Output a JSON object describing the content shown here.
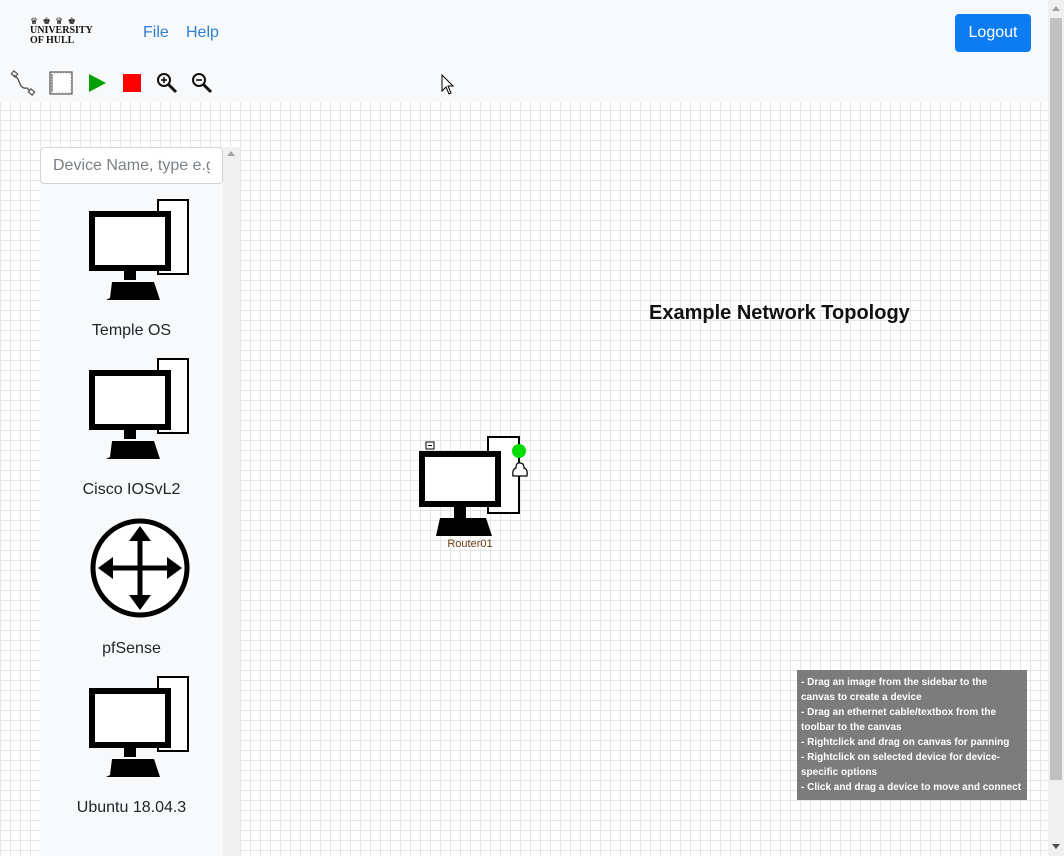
{
  "header": {
    "logo": {
      "crowns": "♛ ♚ ♛ ♚",
      "line1": "UNIVERSITY",
      "line2": "OF HULL"
    },
    "menu": [
      {
        "label": "File"
      },
      {
        "label": "Help"
      }
    ],
    "logout_label": "Logout"
  },
  "toolbar": {
    "tools": [
      {
        "icon": "ethernet-cable-icon"
      },
      {
        "icon": "textbox-icon"
      },
      {
        "icon": "play-icon",
        "color": "#00a000"
      },
      {
        "icon": "stop-icon",
        "color": "#ff0000"
      },
      {
        "icon": "zoom-in-icon"
      },
      {
        "icon": "zoom-out-icon"
      }
    ]
  },
  "sidebar": {
    "search_placeholder": "Device Name, type e.g",
    "devices": [
      {
        "label": "Temple OS",
        "icon": "computer-icon"
      },
      {
        "label": "Cisco IOSvL2",
        "icon": "computer-icon"
      },
      {
        "label": "pfSense",
        "icon": "router-icon"
      },
      {
        "label": "Ubuntu 18.04.3",
        "icon": "computer-icon"
      }
    ]
  },
  "canvas": {
    "title": "Example Network Topology",
    "nodes": [
      {
        "label": "Router01",
        "status_color": "#00dd00"
      }
    ],
    "help": [
      "- Drag an image from the sidebar to the canvas to create a device",
      "- Drag an ethernet cable/textbox from the toolbar to the canvas",
      "- Rightclick and drag on canvas for panning",
      "- Rightclick on selected device for device-specific options",
      "- Click and drag a device to move and connect"
    ]
  },
  "colors": {
    "accent": "#0d7cf2",
    "link": "#2f7fd3"
  }
}
